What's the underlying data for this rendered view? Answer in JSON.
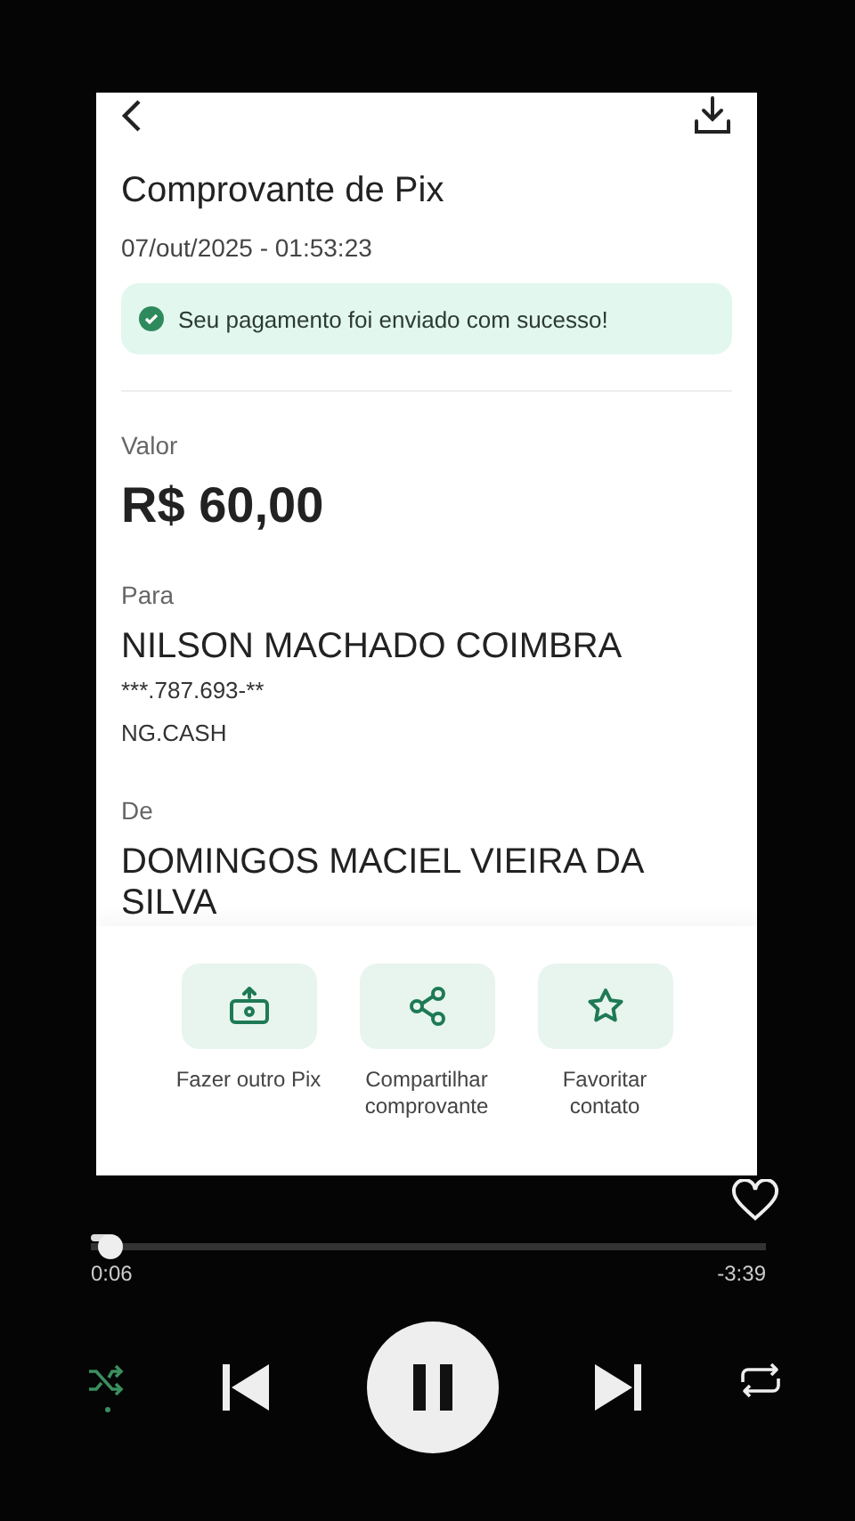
{
  "receipt": {
    "title": "Comprovante de Pix",
    "datetime": "07/out/2025 - 01:53:23",
    "banner": "Seu pagamento foi enviado com sucesso!",
    "value": {
      "label": "Valor",
      "amount": "R$ 60,00"
    },
    "to": {
      "label": "Para",
      "name": "NILSON MACHADO COIMBRA",
      "document": "***.787.693-**",
      "institution": "NG.CASH"
    },
    "from": {
      "label": "De",
      "name": "DOMINGOS MACIEL VIEIRA DA SILVA"
    }
  },
  "actions": [
    {
      "kind": "pix",
      "label": "Fazer outro Pix"
    },
    {
      "kind": "share",
      "label": "Compartilhar comprovante"
    },
    {
      "kind": "favorite",
      "label": "Favoritar contato"
    }
  ],
  "player": {
    "liked": false,
    "level": 0.03,
    "elapsed": "0:06",
    "remaining": "-3:39",
    "controls": [
      {
        "kind": "shuffle",
        "on": true
      },
      {
        "kind": "previous"
      },
      {
        "kind": "pause"
      },
      {
        "kind": "next"
      },
      {
        "kind": "repeat",
        "on": false
      }
    ]
  }
}
